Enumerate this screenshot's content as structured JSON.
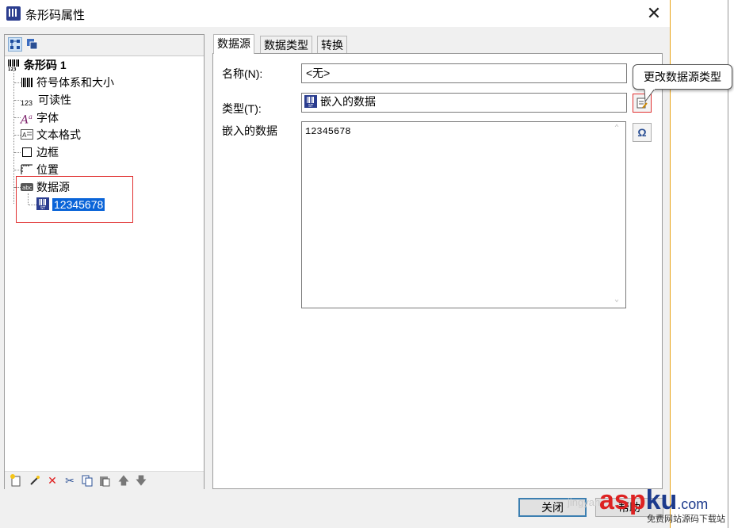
{
  "window": {
    "title": "条形码属性",
    "accent_border": "#e8a317"
  },
  "tree": {
    "root_label": "条形码 1",
    "items": [
      {
        "label": "符号体系和大小",
        "icon": "barcode-icon"
      },
      {
        "label": "可读性",
        "icon": "digits-icon"
      },
      {
        "label": "字体",
        "icon": "font-icon"
      },
      {
        "label": "文本格式",
        "icon": "text-format-icon"
      },
      {
        "label": "边框",
        "icon": "border-icon"
      },
      {
        "label": "位置",
        "icon": "position-icon"
      },
      {
        "label": "数据源",
        "icon": "datasource-icon"
      }
    ],
    "child_label": "12345678",
    "selected_color": "#0a64d8"
  },
  "tabs": [
    {
      "label": "数据源",
      "active": true
    },
    {
      "label": "数据类型",
      "active": false
    },
    {
      "label": "转换",
      "active": false
    }
  ],
  "form": {
    "name_label": "名称(N):",
    "name_value": "<无>",
    "type_label": "类型(T):",
    "type_value": "嵌入的数据",
    "embedded_label": "嵌入的数据",
    "embedded_value": "12345678"
  },
  "tooltip": "更改数据源类型",
  "buttons": {
    "close": "关闭",
    "help": "帮助"
  },
  "watermark": {
    "asp": "asp",
    "ku": "ku",
    "com": ".com",
    "sub": "免费网站源码下载站",
    "faint": "jingyan"
  }
}
